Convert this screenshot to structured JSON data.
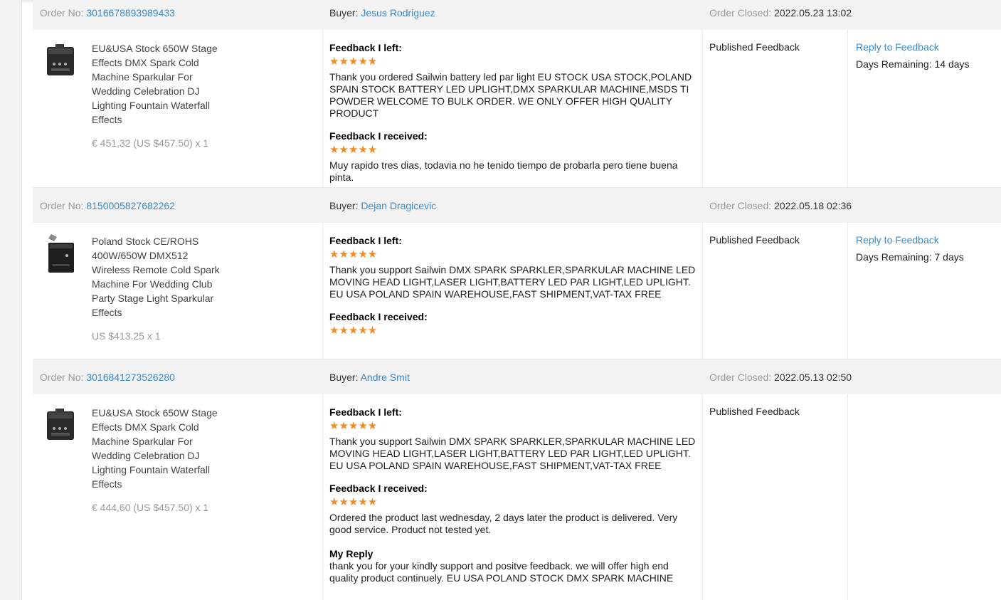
{
  "labels": {
    "order_no": "Order No:",
    "buyer": "Buyer:",
    "order_closed": "Order Closed:",
    "feedback_left": "Feedback I left:",
    "feedback_received": "Feedback I received:",
    "my_reply": "My Reply",
    "stars": "★★★★★",
    "status": "Published Feedback",
    "reply_link": "Reply to Feedback"
  },
  "colors": {
    "link": "#3c8ac8",
    "star": "#f58a1f",
    "header_bg": "#f2f2f2"
  },
  "orders": [
    {
      "order_no": "3016678893989433",
      "buyer": "Jesus Rodriguez",
      "closed": "2022.05.23 13:02",
      "product_name": "EU&USA Stock 650W Stage Effects DMX Spark Cold Machine Sparkular For Wedding Celebration DJ Lighting Fountain Waterfall Effects",
      "price": "€ 451,32 (US $457.50) x 1",
      "feedback_left": "Thank you ordered Sailwin battery led par light EU STOCK USA STOCK,POLAND SPAIN STOCK BATTERY LED UPLIGHT,DMX SPARKULAR MACHINE,MSDS TI POWDER WELCOME TO BULK ORDER. WE ONLY OFFER HIGH QUALITY PRODUCT",
      "feedback_received": "Muy rapido tres dias, todavia no he tenido tiempo de probarla pero tiene buena pinta.",
      "days_remaining": "Days Remaining: 14 days"
    },
    {
      "order_no": "8150005827682262",
      "buyer": "Dejan Dragicevic",
      "closed": "2022.05.18 02:36",
      "product_name": "Poland Stock CE/ROHS 400W/650W DMX512 Wireless Remote Cold Spark Machine For Wedding Club Party Stage Light Sparkular Effects",
      "price": "US $413.25 x 1",
      "feedback_left": "Thank you support Sailwin DMX SPARK SPARKLER,SPARKULAR MACHINE LED MOVING HEAD LIGHT,LASER LIGHT,BATTERY LED PAR LIGHT,LED UPLIGHT. EU USA POLAND SPAIN WAREHOUSE,FAST SHIPMENT,VAT-TAX FREE",
      "days_remaining": "Days Remaining: 7 days"
    },
    {
      "order_no": "3016841273526280",
      "buyer": "Andre Smit",
      "closed": "2022.05.13 02:50",
      "product_name": "EU&USA Stock 650W Stage Effects DMX Spark Cold Machine Sparkular For Wedding Celebration DJ Lighting Fountain Waterfall Effects",
      "price": "€ 444,60 (US $457.50) x 1",
      "feedback_left": "Thank you support Sailwin DMX SPARK SPARKLER,SPARKULAR MACHINE LED MOVING HEAD LIGHT,LASER LIGHT,BATTERY LED PAR LIGHT,LED UPLIGHT. EU USA POLAND SPAIN WAREHOUSE,FAST SHIPMENT,VAT-TAX FREE",
      "feedback_received": "Ordered the product last wednesday, 2 days later the product is delivered. Very good service. Product not tested yet.",
      "reply": "thank you for your kindly support and positve feedback. we will offer high end quality product continuely. EU USA POLAND STOCK DMX SPARK MACHINE"
    }
  ]
}
